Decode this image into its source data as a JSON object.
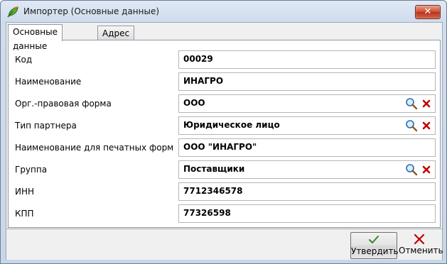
{
  "window": {
    "title": "Импортер (Основные данные)",
    "close_symbol": "✕"
  },
  "tabs": [
    {
      "label": "Основные данные",
      "active": true
    },
    {
      "label": "Адрес",
      "active": false
    }
  ],
  "fields": [
    {
      "label": "Код",
      "value": "00029",
      "lookup": false
    },
    {
      "label": "Наименование",
      "value": "ИНАГРО",
      "lookup": false
    },
    {
      "label": "Орг.-правовая форма",
      "value": "ООО",
      "lookup": true
    },
    {
      "label": "Тип партнера",
      "value": "Юридическое лицо",
      "lookup": true
    },
    {
      "label": "Наименование для печатных форм",
      "value": "ООО \"ИНАГРО\"",
      "lookup": false
    },
    {
      "label": "Группа",
      "value": "Поставщики",
      "lookup": true
    },
    {
      "label": "ИНН",
      "value": "7712346578",
      "lookup": false
    },
    {
      "label": "КПП",
      "value": "77326598",
      "lookup": false
    }
  ],
  "footer": {
    "confirm_label": "Утвердить",
    "cancel_label": "Отменить"
  },
  "icons": {
    "app": "app-leaf-icon",
    "search": "magnifier-search-icon",
    "clear": "red-x-clear-icon",
    "confirm": "green-checkmark-icon",
    "cancel": "red-x-cancel-icon"
  },
  "colors": {
    "title_bar": "#dfe9f5",
    "close_button": "#cc4a2e",
    "field_border": "#b5b5b5",
    "confirm_check": "#2e8b2e",
    "cancel_x": "#c00000"
  }
}
